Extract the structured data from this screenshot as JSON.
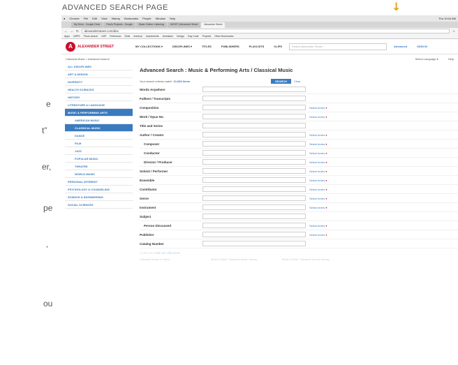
{
  "caption": "ADVANCED SEARCH PAGE",
  "left_fragments": [
    "e",
    "t”",
    "er,",
    "pe",
    "’",
    "ou"
  ],
  "menubar": {
    "items": [
      "Chrome",
      "File",
      "Edit",
      "View",
      "History",
      "Bookmarks",
      "People",
      "Window",
      "Help"
    ],
    "clock": "Thu 10:04 AM"
  },
  "tabs": [
    "My Drive - Google Drive",
    "Paul's Projects - Google",
    "Music Online: Listening",
    "MOOP | Alexander Street",
    "Alexander Street"
  ],
  "url": "alexanderstreet.com/dev",
  "bookmarks": [
    "Apps",
    "LWPS",
    "Photo search",
    "ASP",
    "Reference",
    "Drills",
    "Archival",
    "Investments",
    "Animation",
    "Design",
    "Day Code",
    "Projects",
    "Other Bookmarks"
  ],
  "site": {
    "logo": "ALEXANDER STREET",
    "nav": [
      "MY COLLECTIONS ▾",
      "DISCIPLINES ▾",
      "TITLES",
      "PUBLISHERS",
      "PLAYLISTS",
      "CLIPS"
    ],
    "search_placeholder": "Search Alexander Street...",
    "advanced": "Advanced",
    "signin": "SIGN IN",
    "breadcrumb": "Classical Music  >  Advanced search",
    "language": "Select Language ▾",
    "help": "Help"
  },
  "sidebar": [
    {
      "label": "ALL DISCIPLINES",
      "kind": ""
    },
    {
      "label": "ART & DESIGN",
      "kind": ""
    },
    {
      "label": "DIVERSITY",
      "kind": ""
    },
    {
      "label": "HEALTH SCIENCES",
      "kind": ""
    },
    {
      "label": "HISTORY",
      "kind": ""
    },
    {
      "label": "LITERATURE & LANGUAGE",
      "kind": ""
    },
    {
      "label": "MUSIC & PERFORMING ARTS",
      "kind": "parent"
    },
    {
      "label": "AMERICAN MUSIC",
      "kind": "sub"
    },
    {
      "label": "CLASSICAL MUSIC",
      "kind": "active"
    },
    {
      "label": "DANCE",
      "kind": "sub"
    },
    {
      "label": "FILM",
      "kind": "sub"
    },
    {
      "label": "JAZZ",
      "kind": "sub"
    },
    {
      "label": "POPULAR MUSIC",
      "kind": "sub"
    },
    {
      "label": "THEATRE",
      "kind": "sub"
    },
    {
      "label": "WORLD MUSIC",
      "kind": "sub"
    },
    {
      "label": "PERSONAL INTEREST",
      "kind": ""
    },
    {
      "label": "PSYCHOLOGY & COUNSELING",
      "kind": ""
    },
    {
      "label": "SCIENCE & ENGINEERING",
      "kind": ""
    },
    {
      "label": "SOCIAL SCIENCES",
      "kind": ""
    }
  ],
  "main": {
    "title": "Advanced Search : Music & Performing Arts / Classical Music",
    "criteria_text": "Your search criteria match",
    "criteria_count": "10,668 items",
    "search_button": "SEARCH",
    "clear": "Clear",
    "select_terms": "Select terms",
    "fields": [
      {
        "label": "Words Anywhere",
        "select": false,
        "indent": false
      },
      {
        "label": "Fulltext / Transcripts",
        "select": false,
        "indent": false
      },
      {
        "label": "Composition",
        "select": true,
        "indent": false
      },
      {
        "label": "Work / Opus No.",
        "select": true,
        "indent": false
      },
      {
        "label": "Title and Series",
        "select": false,
        "indent": false
      },
      {
        "label": "Author / Creator",
        "select": true,
        "indent": false
      },
      {
        "label": "Composer",
        "select": true,
        "indent": true
      },
      {
        "label": "Conductor",
        "select": true,
        "indent": true
      },
      {
        "label": "Director / Producer",
        "select": true,
        "indent": true
      },
      {
        "label": "Soloist / Performer",
        "select": true,
        "indent": false
      },
      {
        "label": "Ensemble",
        "select": true,
        "indent": false
      },
      {
        "label": "Contributor",
        "select": true,
        "indent": false
      },
      {
        "label": "Genre",
        "select": true,
        "indent": false
      },
      {
        "label": "Instrument",
        "select": true,
        "indent": false
      },
      {
        "label": "Subject",
        "select": false,
        "indent": false
      },
      {
        "label": "Person Discussed",
        "select": true,
        "indent": true
      },
      {
        "label": "Publisher",
        "select": true,
        "indent": false
      },
      {
        "label": "Catalog Number",
        "select": false,
        "indent": false
      }
    ],
    "collection_label": "Collection",
    "collection_hide": "Hide all collections",
    "collections": [
      "Classical Music in Video",
      "Music Online: Classical Music Library",
      "Music Online: Classical Scores Library"
    ]
  }
}
